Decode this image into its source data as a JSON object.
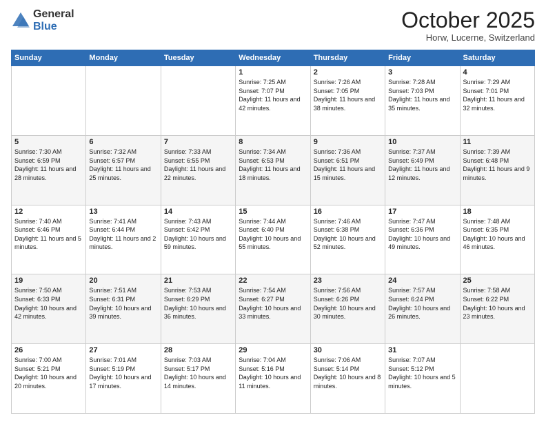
{
  "logo": {
    "general": "General",
    "blue": "Blue"
  },
  "header": {
    "month": "October 2025",
    "location": "Horw, Lucerne, Switzerland"
  },
  "days_of_week": [
    "Sunday",
    "Monday",
    "Tuesday",
    "Wednesday",
    "Thursday",
    "Friday",
    "Saturday"
  ],
  "weeks": [
    [
      {
        "day": "",
        "text": ""
      },
      {
        "day": "",
        "text": ""
      },
      {
        "day": "",
        "text": ""
      },
      {
        "day": "1",
        "text": "Sunrise: 7:25 AM\nSunset: 7:07 PM\nDaylight: 11 hours and 42 minutes."
      },
      {
        "day": "2",
        "text": "Sunrise: 7:26 AM\nSunset: 7:05 PM\nDaylight: 11 hours and 38 minutes."
      },
      {
        "day": "3",
        "text": "Sunrise: 7:28 AM\nSunset: 7:03 PM\nDaylight: 11 hours and 35 minutes."
      },
      {
        "day": "4",
        "text": "Sunrise: 7:29 AM\nSunset: 7:01 PM\nDaylight: 11 hours and 32 minutes."
      }
    ],
    [
      {
        "day": "5",
        "text": "Sunrise: 7:30 AM\nSunset: 6:59 PM\nDaylight: 11 hours and 28 minutes."
      },
      {
        "day": "6",
        "text": "Sunrise: 7:32 AM\nSunset: 6:57 PM\nDaylight: 11 hours and 25 minutes."
      },
      {
        "day": "7",
        "text": "Sunrise: 7:33 AM\nSunset: 6:55 PM\nDaylight: 11 hours and 22 minutes."
      },
      {
        "day": "8",
        "text": "Sunrise: 7:34 AM\nSunset: 6:53 PM\nDaylight: 11 hours and 18 minutes."
      },
      {
        "day": "9",
        "text": "Sunrise: 7:36 AM\nSunset: 6:51 PM\nDaylight: 11 hours and 15 minutes."
      },
      {
        "day": "10",
        "text": "Sunrise: 7:37 AM\nSunset: 6:49 PM\nDaylight: 11 hours and 12 minutes."
      },
      {
        "day": "11",
        "text": "Sunrise: 7:39 AM\nSunset: 6:48 PM\nDaylight: 11 hours and 9 minutes."
      }
    ],
    [
      {
        "day": "12",
        "text": "Sunrise: 7:40 AM\nSunset: 6:46 PM\nDaylight: 11 hours and 5 minutes."
      },
      {
        "day": "13",
        "text": "Sunrise: 7:41 AM\nSunset: 6:44 PM\nDaylight: 11 hours and 2 minutes."
      },
      {
        "day": "14",
        "text": "Sunrise: 7:43 AM\nSunset: 6:42 PM\nDaylight: 10 hours and 59 minutes."
      },
      {
        "day": "15",
        "text": "Sunrise: 7:44 AM\nSunset: 6:40 PM\nDaylight: 10 hours and 55 minutes."
      },
      {
        "day": "16",
        "text": "Sunrise: 7:46 AM\nSunset: 6:38 PM\nDaylight: 10 hours and 52 minutes."
      },
      {
        "day": "17",
        "text": "Sunrise: 7:47 AM\nSunset: 6:36 PM\nDaylight: 10 hours and 49 minutes."
      },
      {
        "day": "18",
        "text": "Sunrise: 7:48 AM\nSunset: 6:35 PM\nDaylight: 10 hours and 46 minutes."
      }
    ],
    [
      {
        "day": "19",
        "text": "Sunrise: 7:50 AM\nSunset: 6:33 PM\nDaylight: 10 hours and 42 minutes."
      },
      {
        "day": "20",
        "text": "Sunrise: 7:51 AM\nSunset: 6:31 PM\nDaylight: 10 hours and 39 minutes."
      },
      {
        "day": "21",
        "text": "Sunrise: 7:53 AM\nSunset: 6:29 PM\nDaylight: 10 hours and 36 minutes."
      },
      {
        "day": "22",
        "text": "Sunrise: 7:54 AM\nSunset: 6:27 PM\nDaylight: 10 hours and 33 minutes."
      },
      {
        "day": "23",
        "text": "Sunrise: 7:56 AM\nSunset: 6:26 PM\nDaylight: 10 hours and 30 minutes."
      },
      {
        "day": "24",
        "text": "Sunrise: 7:57 AM\nSunset: 6:24 PM\nDaylight: 10 hours and 26 minutes."
      },
      {
        "day": "25",
        "text": "Sunrise: 7:58 AM\nSunset: 6:22 PM\nDaylight: 10 hours and 23 minutes."
      }
    ],
    [
      {
        "day": "26",
        "text": "Sunrise: 7:00 AM\nSunset: 5:21 PM\nDaylight: 10 hours and 20 minutes."
      },
      {
        "day": "27",
        "text": "Sunrise: 7:01 AM\nSunset: 5:19 PM\nDaylight: 10 hours and 17 minutes."
      },
      {
        "day": "28",
        "text": "Sunrise: 7:03 AM\nSunset: 5:17 PM\nDaylight: 10 hours and 14 minutes."
      },
      {
        "day": "29",
        "text": "Sunrise: 7:04 AM\nSunset: 5:16 PM\nDaylight: 10 hours and 11 minutes."
      },
      {
        "day": "30",
        "text": "Sunrise: 7:06 AM\nSunset: 5:14 PM\nDaylight: 10 hours and 8 minutes."
      },
      {
        "day": "31",
        "text": "Sunrise: 7:07 AM\nSunset: 5:12 PM\nDaylight: 10 hours and 5 minutes."
      },
      {
        "day": "",
        "text": ""
      }
    ]
  ]
}
